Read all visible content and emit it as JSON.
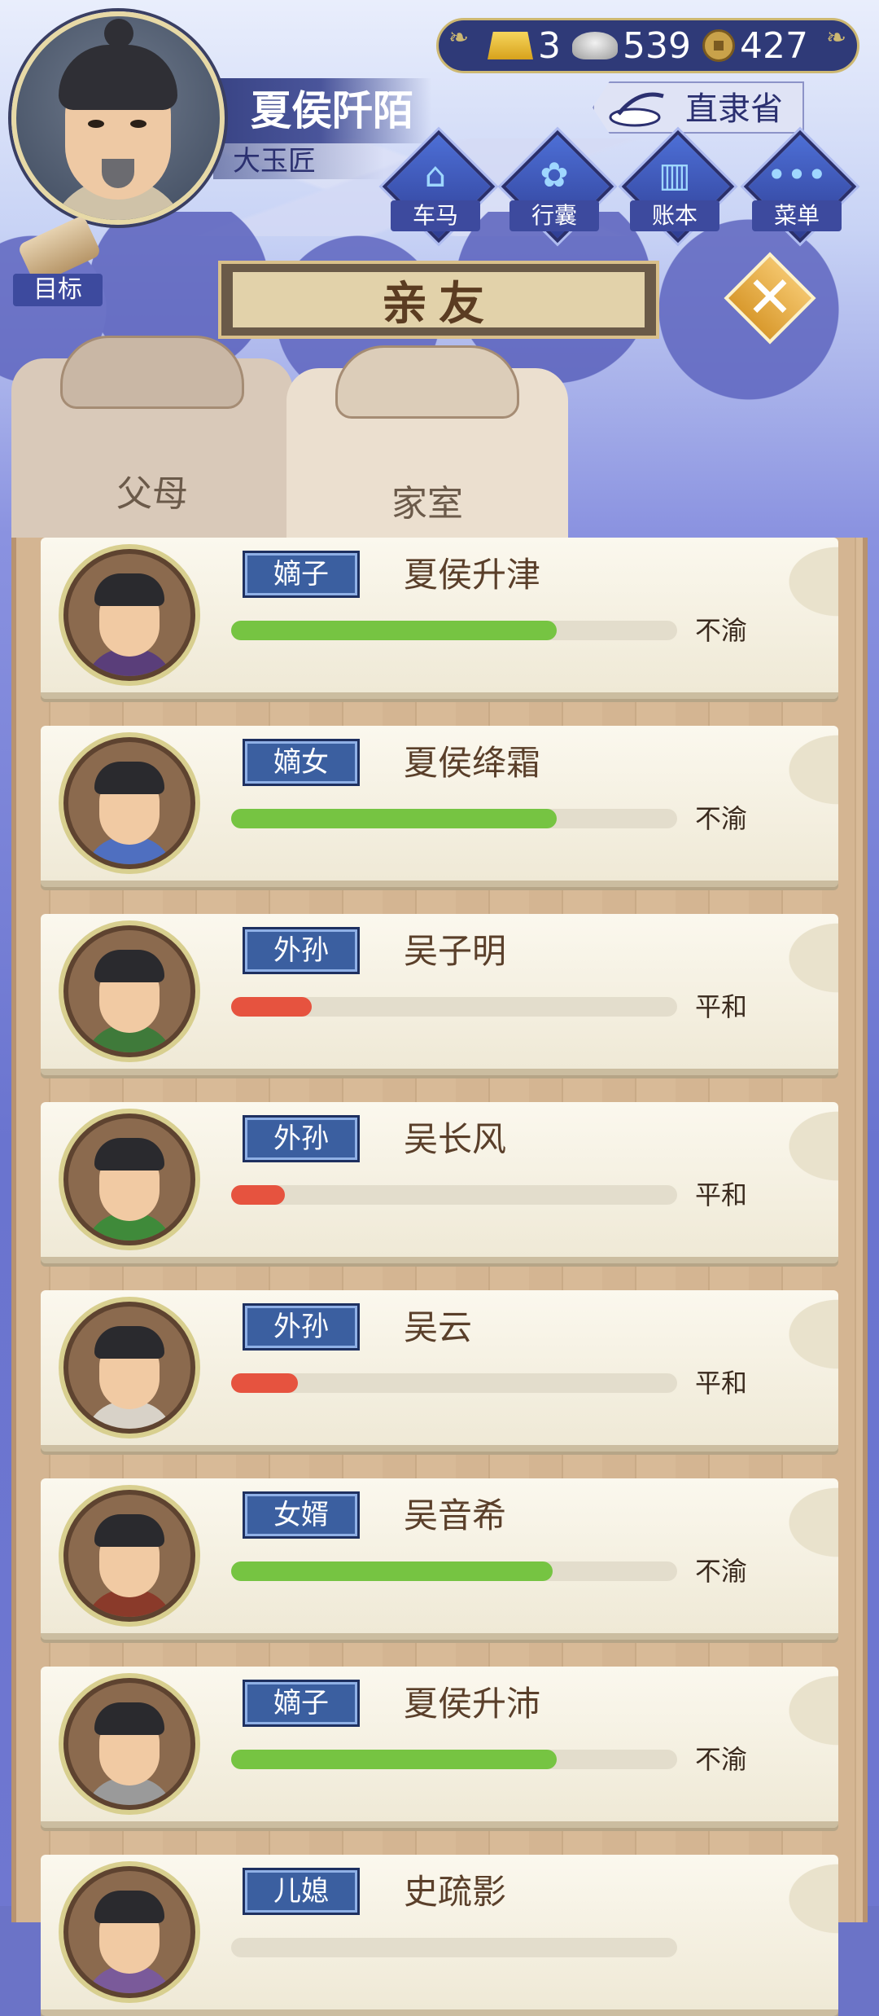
{
  "player": {
    "name": "夏侯阡陌",
    "title": "大玉匠"
  },
  "currency": {
    "gold": "3",
    "silver": "539",
    "copper": "427"
  },
  "location": "直隶省",
  "nav": [
    {
      "label": "车马",
      "icon": "carriage-icon"
    },
    {
      "label": "行囊",
      "icon": "bag-icon"
    },
    {
      "label": "账本",
      "icon": "ledger-icon"
    },
    {
      "label": "菜单",
      "icon": "menu-dots-icon"
    }
  ],
  "goal_label": "目标",
  "page_title": "亲友",
  "tabs": [
    {
      "label": "父母",
      "active": false
    },
    {
      "label": "家室",
      "active": true
    }
  ],
  "colors": {
    "bar_green": "#76c442",
    "bar_red": "#e6533f",
    "tag_blue": "#3b5fa0"
  },
  "relatives": [
    {
      "role": "嫡子",
      "name": "夏侯升津",
      "relation": 0.73,
      "mood": "不渝",
      "bar": "green",
      "robe": "#5a3e7a"
    },
    {
      "role": "嫡女",
      "name": "夏侯绛霜",
      "relation": 0.73,
      "mood": "不渝",
      "bar": "green",
      "robe": "#4f6fc0"
    },
    {
      "role": "外孙",
      "name": "吴子明",
      "relation": 0.18,
      "mood": "平和",
      "bar": "red",
      "robe": "#3f7a3a"
    },
    {
      "role": "外孙",
      "name": "吴长风",
      "relation": 0.12,
      "mood": "平和",
      "bar": "red",
      "robe": "#3f8a3a"
    },
    {
      "role": "外孙",
      "name": "吴云",
      "relation": 0.15,
      "mood": "平和",
      "bar": "red",
      "robe": "#d8d2c8"
    },
    {
      "role": "女婿",
      "name": "吴音希",
      "relation": 0.72,
      "mood": "不渝",
      "bar": "green",
      "robe": "#8a3a2a"
    },
    {
      "role": "嫡子",
      "name": "夏侯升沛",
      "relation": 0.73,
      "mood": "不渝",
      "bar": "green",
      "robe": "#9a9a9a"
    },
    {
      "role": "儿媳",
      "name": "史疏影",
      "relation": 0.0,
      "mood": "",
      "bar": "green",
      "robe": "#7a5a9a"
    }
  ]
}
